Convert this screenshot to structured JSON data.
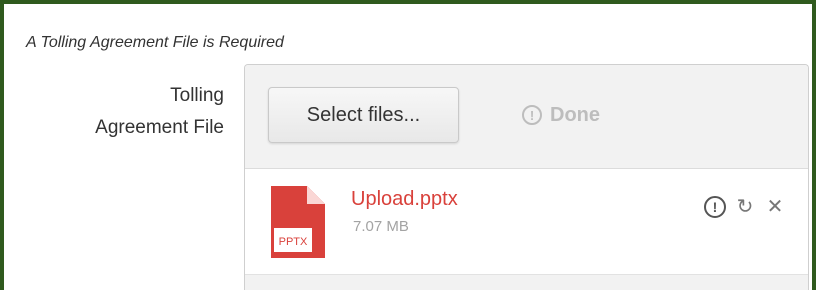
{
  "form": {
    "notice": "A Tolling Agreement File is Required",
    "field_label_line1": "Tolling",
    "field_label_line2": "Agreement File"
  },
  "upload": {
    "select_button_label": "Select files...",
    "done_label": "Done",
    "status_icon_glyph": "!",
    "files": [
      {
        "name": "Upload.pptx",
        "size": "7.07 MB",
        "type_label": "PPTX",
        "icon": "pptx-file-icon",
        "status_icon": "warning-icon",
        "retry_icon": "retry-icon",
        "remove_icon": "close-icon",
        "retry_glyph": "↻",
        "remove_glyph": "✕"
      }
    ]
  },
  "colors": {
    "frame_border": "#2f5a1e",
    "error_red": "#d9413b",
    "muted_gray": "#bdbdbd"
  }
}
